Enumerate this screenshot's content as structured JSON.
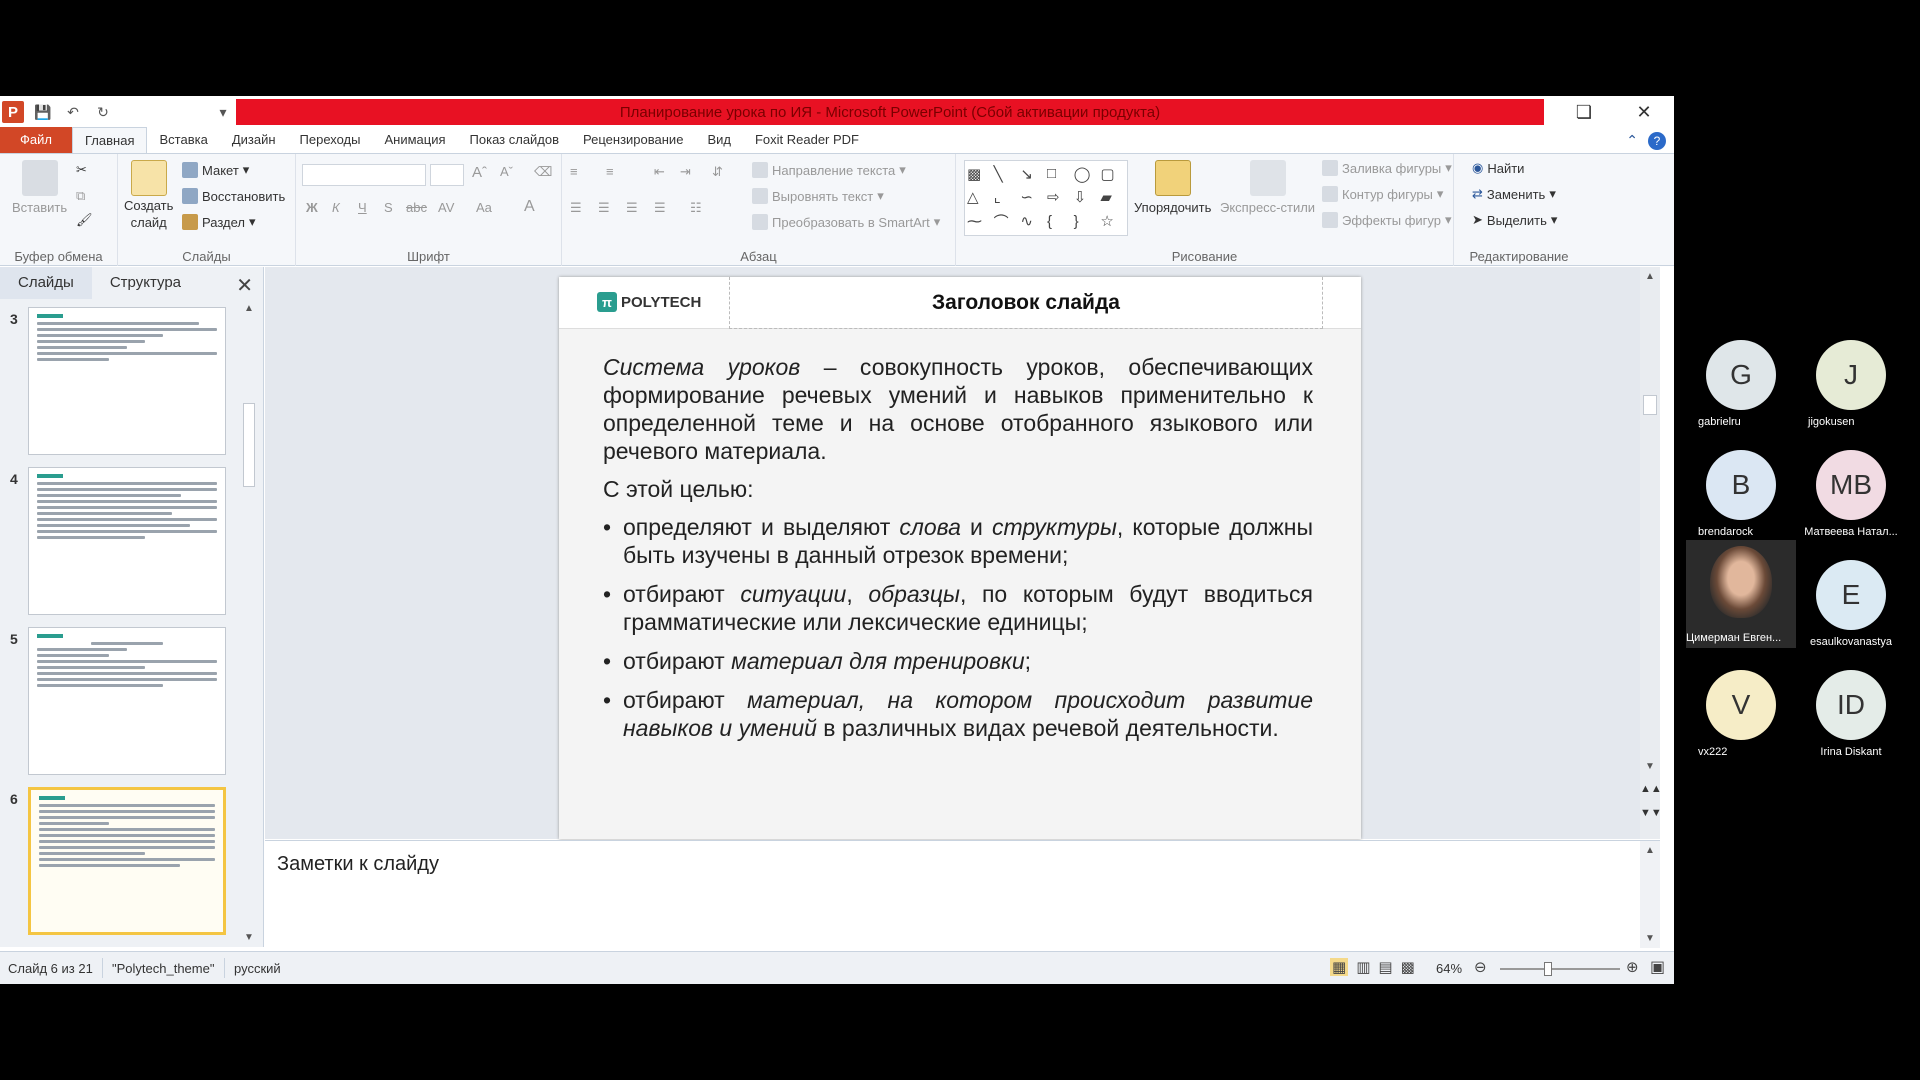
{
  "window": {
    "title": "Планирование урока по ИЯ  -  Microsoft PowerPoint (Сбой активации продукта)"
  },
  "tabs": [
    {
      "label": "Файл"
    },
    {
      "label": "Главная"
    },
    {
      "label": "Вставка"
    },
    {
      "label": "Дизайн"
    },
    {
      "label": "Переходы"
    },
    {
      "label": "Анимация"
    },
    {
      "label": "Показ слайдов"
    },
    {
      "label": "Рецензирование"
    },
    {
      "label": "Вид"
    },
    {
      "label": "Foxit Reader PDF"
    }
  ],
  "ribbon": {
    "clipboard": {
      "paste": "Вставить",
      "label": "Буфер обмена"
    },
    "slides": {
      "new_slide_1": "Создать",
      "new_slide_2": "слайд",
      "layout": "Макет",
      "reset": "Восстановить",
      "section": "Раздел",
      "label": "Слайды"
    },
    "font": {
      "bold": "Ж",
      "italic": "К",
      "underline": "Ч",
      "shadow": "S",
      "strike": "abc",
      "spacing": "AV",
      "case": "Aa",
      "label": "Шрифт"
    },
    "paragraph": {
      "text_direction": "Направление текста",
      "align_text": "Выровнять текст",
      "smartart": "Преобразовать в SmartArt",
      "label": "Абзац"
    },
    "drawing": {
      "arrange": "Упорядочить",
      "quick_styles": "Экспресс-стили",
      "fill": "Заливка фигуры",
      "outline": "Контур фигуры",
      "effects": "Эффекты фигур",
      "label": "Рисование"
    },
    "editing": {
      "find": "Найти",
      "replace": "Заменить",
      "select": "Выделить",
      "label": "Редактирование"
    }
  },
  "panel": {
    "tab_slides": "Слайды",
    "tab_outline": "Структура",
    "thumbs": [
      {
        "num": "3"
      },
      {
        "num": "4"
      },
      {
        "num": "5"
      },
      {
        "num": "6"
      }
    ]
  },
  "slide": {
    "logo": "POLYTECH",
    "title": "Заголовок слайда",
    "p1_em": "Система уроков",
    "p1_rest": " – совокупность уроков, обеспечивающих формирование речевых умений и навыков применительно к определенной теме и на основе отобранного языкового или речевого материала.",
    "p2": "С этой целью:",
    "b1_a": "определяют и выделяют ",
    "b1_em1": "слова",
    "b1_b": " и ",
    "b1_em2": "структуры",
    "b1_c": ", которые должны быть изучены в данный отрезок времени;",
    "b2_a": "отбирают ",
    "b2_em1": "ситуации",
    "b2_b": ", ",
    "b2_em2": "образцы",
    "b2_c": ", по которым будут вводиться грамматические или лексические единицы;",
    "b3_a": "отбирают ",
    "b3_em": "материал для тренировки",
    "b3_c": ";",
    "b4_a": "отбирают ",
    "b4_em": "материал, на котором происходит развитие навыков и умений",
    "b4_c": " в различных видах речевой деятельности."
  },
  "notes": {
    "placeholder": "Заметки к слайду"
  },
  "status": {
    "slide_counter": "Слайд 6 из 21",
    "theme": "\"Polytech_theme\"",
    "language": "русский",
    "zoom": "64%"
  },
  "participants": [
    {
      "initials": "G",
      "name": "gabrielru",
      "color": "#dfe6e9"
    },
    {
      "initials": "J",
      "name": "jigokusen",
      "color": "#e6ebd6"
    },
    {
      "initials": "B",
      "name": "brendarock",
      "color": "#dbe7f3"
    },
    {
      "initials": "MB",
      "name": "Матвеева Натал...",
      "color": "#f1dbe3"
    },
    {
      "initials": "",
      "name": "Цимерман Евген...",
      "color": "#2b2b2b"
    },
    {
      "initials": "E",
      "name": "esaulkovanastya",
      "color": "#dbeaf3"
    },
    {
      "initials": "V",
      "name": "vx222",
      "color": "#f6edc7"
    },
    {
      "initials": "ID",
      "name": "Irina Diskant",
      "color": "#e4ece8"
    }
  ],
  "colors": {
    "title_bar": "#e81123",
    "file_tab": "#d24726",
    "selection": "#f4c542",
    "logo_green": "#2a9d8f"
  }
}
